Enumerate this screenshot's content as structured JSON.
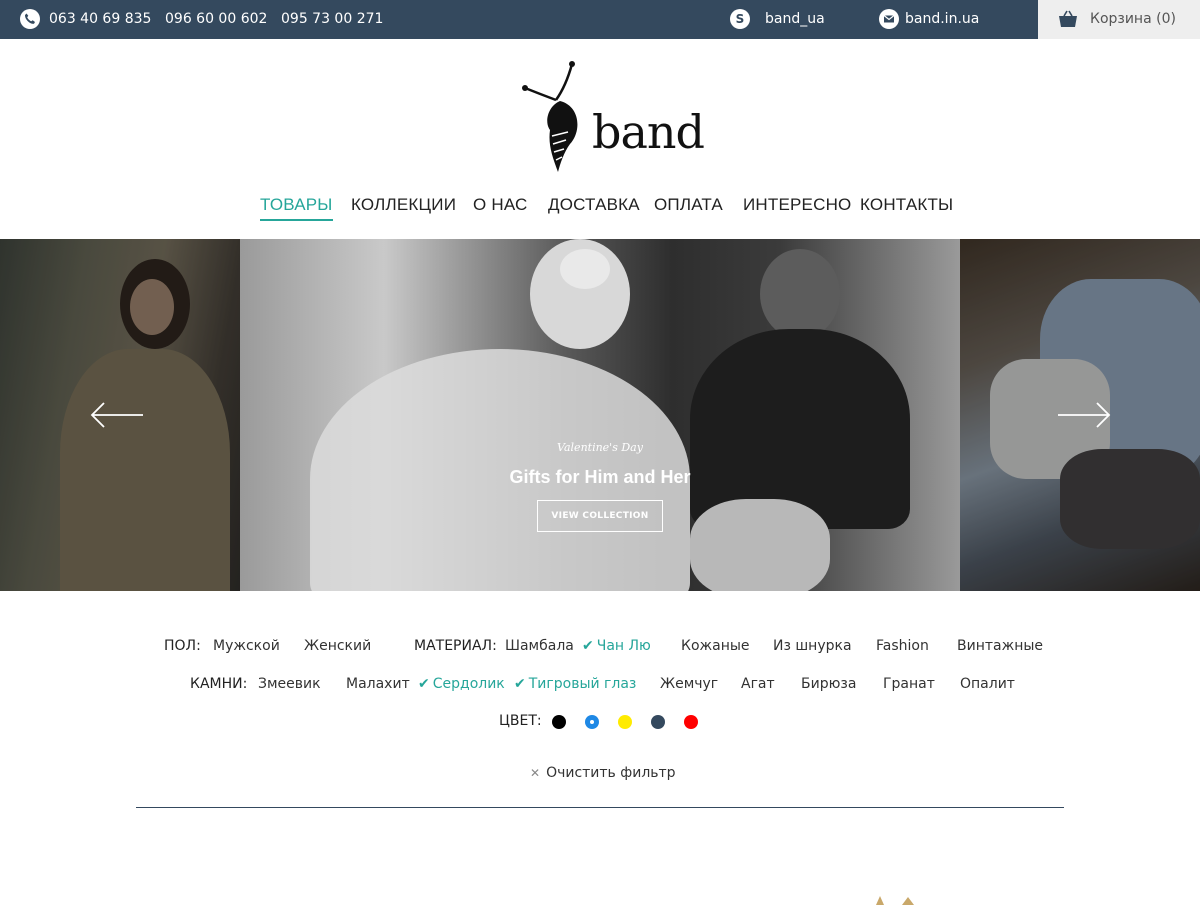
{
  "topbar": {
    "phones": [
      "063 40 69 835",
      "096 60 00 602",
      "095 73 00 271"
    ],
    "skype": "band_ua",
    "email": "band.in.ua",
    "cart_label": "Корзина (0)"
  },
  "logo": {
    "text": "band"
  },
  "nav": {
    "items": [
      "ТОВАРЫ",
      "КОЛЛЕКЦИИ",
      "О НАС",
      "ДОСТАВКА",
      "ОПЛАТА",
      "ИНТЕРЕСНО",
      "КОНТАКТЫ"
    ],
    "active": "ТОВАРЫ"
  },
  "slider": {
    "caption_small": "Valentine's Day",
    "caption_title": "Gifts for Him and Her",
    "button_label": "VIEW COLLECTION"
  },
  "filters": {
    "gender": {
      "label": "ПОЛ:",
      "options": [
        "Мужской",
        "Женский"
      ]
    },
    "material": {
      "label": "МАТЕРИАЛ:",
      "options": [
        "Шамбала",
        "Чан Лю",
        "Кожаные",
        "Из шнурка",
        "Fashion",
        "Винтажные"
      ],
      "checked": [
        "Чан Лю"
      ]
    },
    "stones": {
      "label": "КАМНИ:",
      "options": [
        "Змеевик",
        "Малахит",
        "Сердолик",
        "Тигровый глаз",
        "Жемчуг",
        "Агат",
        "Бирюза",
        "Гранат",
        "Опалит"
      ],
      "checked": [
        "Сердолик",
        "Тигровый глаз"
      ]
    },
    "color": {
      "label": "ЦВЕТ:",
      "swatches": [
        "#000000",
        "#1e88e5",
        "#ffeb00",
        "#34495e",
        "#ff0000"
      ],
      "selected": "#1e88e5"
    },
    "clear_label": "Очистить фильтр"
  },
  "colors": {
    "topbar": "#34495e",
    "accent": "#26a69a"
  }
}
